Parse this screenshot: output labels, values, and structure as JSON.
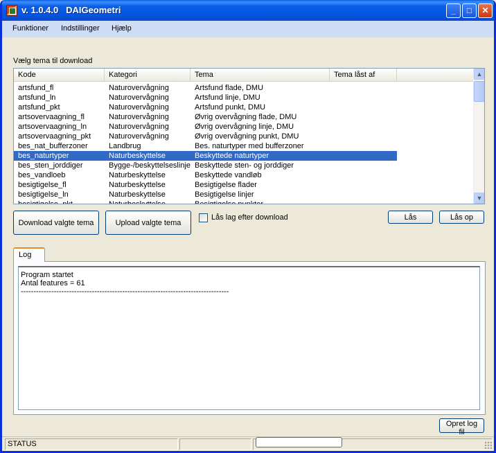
{
  "window": {
    "title": "v. 1.0.4.0   DAIGeometri",
    "controls": {
      "minimize": "_",
      "maximize": "□",
      "close": "✕"
    }
  },
  "menu": [
    "Funktioner",
    "Indstillinger",
    "Hjælp"
  ],
  "theme_section": {
    "label": "Vælg tema til download",
    "columns": [
      "Kode",
      "Kategori",
      "Tema",
      "Tema låst af"
    ],
    "rows": [
      [
        "artsfund_fl",
        "Naturovervågning",
        "Artsfund flade, DMU",
        ""
      ],
      [
        "artsfund_ln",
        "Naturovervågning",
        "Artsfund linje, DMU",
        ""
      ],
      [
        "artsfund_pkt",
        "Naturovervågning",
        "Artsfund punkt, DMU",
        ""
      ],
      [
        "artsovervaagning_fl",
        "Naturovervågning",
        "Øvrig overvågning flade, DMU",
        ""
      ],
      [
        "artsovervaagning_ln",
        "Naturovervågning",
        "Øvrig overvågning linje, DMU",
        ""
      ],
      [
        "artsovervaagning_pkt",
        "Naturovervågning",
        "Øvrig overvågning punkt, DMU",
        ""
      ],
      [
        "bes_nat_bufferzoner",
        "Landbrug",
        "Bes. naturtyper med bufferzoner",
        ""
      ],
      [
        "bes_naturtyper",
        "Naturbeskyttelse",
        "Beskyttede naturtyper",
        ""
      ],
      [
        "bes_sten_jorddiger",
        "Bygge-/beskyttelseslinjer",
        "Beskyttede sten- og jorddiger",
        ""
      ],
      [
        "bes_vandloeb",
        "Naturbeskyttelse",
        "Beskyttede vandløb",
        ""
      ],
      [
        "besigtigelse_fl",
        "Naturbeskyttelse",
        "Besigtigelse flader",
        ""
      ],
      [
        "besigtigelse_ln",
        "Naturbeskyttelse",
        "Besigtigelse linjer",
        ""
      ],
      [
        "besigtigelse_pkt",
        "Naturbeskyttelse",
        "Besigtigelse punkter",
        ""
      ]
    ],
    "selected_row": 7
  },
  "buttons": {
    "download": "Download valgte tema",
    "upload": "Upload valgte tema",
    "lock": "Lås",
    "unlock": "Lås op",
    "create_log": "Opret log fil"
  },
  "checkbox": {
    "label": "Lås lag efter download",
    "checked": false
  },
  "log": {
    "tab_label": "Log",
    "lines": [
      "Program startet",
      "Antal features = 61",
      "--------------------------------------------------------------------------------------------------"
    ]
  },
  "status": {
    "text": "STATUS",
    "progress": 0
  },
  "icons": {
    "app": "app-icon",
    "scroll_up": "chevron-up-icon",
    "scroll_down": "chevron-down-icon"
  }
}
